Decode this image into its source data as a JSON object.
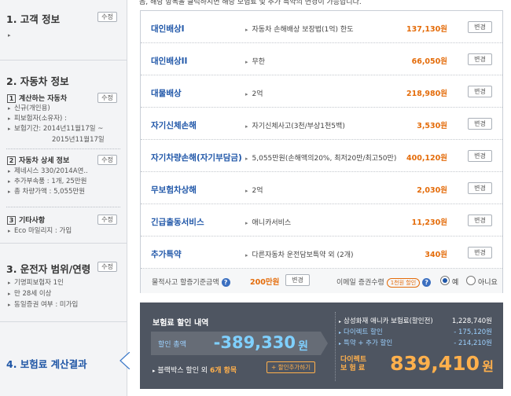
{
  "sidebar": {
    "edit_label": "수정",
    "customer": {
      "title": "1. 고객 정보"
    },
    "car": {
      "title": "2. 자동차 정보",
      "sub1": {
        "num": "1",
        "title": "계산하는 자동차",
        "items": [
          "신규(개인용)",
          "피보험자(소유자) :",
          "보험기간: 2014년11월17일 ~"
        ],
        "indent": "2015년11월17일"
      },
      "sub2": {
        "num": "2",
        "title": "자동차 상세 정보",
        "items": [
          "제네시스 330/2014A연..",
          "추가부속품 : 1개, 25만원",
          "총 차량가액 : 5,055만원"
        ]
      },
      "sub3": {
        "num": "3",
        "title": "기타사항",
        "items": [
          "Eco 마일리지 : 가입"
        ]
      }
    },
    "driver": {
      "title": "3. 운전자 범위/연령",
      "items": [
        "기명피보험자 1인",
        "만 28세 이상",
        "동일증권 여부 : 미가입"
      ]
    },
    "result": {
      "title": "4. 보험료 계산결과"
    }
  },
  "top_text": "음, 해당 항목을 클릭하시면 해당 보험료 및 추가 특약의 변경이 가능합니다.",
  "coverage": {
    "change_label": "변경",
    "rows": [
      {
        "name": "대인배상I",
        "desc": "자동차 손해배상 보장법(1억) 한도",
        "price": "137,130원"
      },
      {
        "name": "대인배상II",
        "desc": "무한",
        "price": "66,050원"
      },
      {
        "name": "대물배상",
        "desc": "2억",
        "price": "218,980원"
      },
      {
        "name": "자기신체손해",
        "desc": "자기신체사고(3천/부상1천5백)",
        "price": "3,530원"
      },
      {
        "name": "자기차량손해(자기부담금)",
        "desc": "5,055만원(손해액의20%, 최저20만/최고50만)",
        "price": "400,120원"
      },
      {
        "name": "무보험차상해",
        "desc": "2억",
        "price": "2,030원"
      },
      {
        "name": "긴급출동서비스",
        "desc": "애니카서비스",
        "price": "11,230원"
      },
      {
        "name": "추가특약",
        "desc": "다른자동차 운전담보특약 외 (2개)",
        "price": "340원"
      }
    ],
    "footer": {
      "damage_label": "물적사고 할증기준금액",
      "damage_value": "200만원",
      "email_label": "이메일 증권수령",
      "email_badge": "1천원 할인",
      "yes": "예",
      "no": "아니요"
    }
  },
  "discount": {
    "title": "보험료 할인 내역",
    "total_label": "할인 총액",
    "total_value": "-389,330",
    "won": "원",
    "blackbox_prefix": "블랙박스 할인 외",
    "blackbox_count": "6개 항목",
    "blackbox_btn": "할인추가하기",
    "breakdown": [
      {
        "label": "삼성화재 애니카 보험료(할인전)",
        "value": "1,228,740원"
      },
      {
        "label": "다이렉트 할인",
        "value": "- 175,120원"
      },
      {
        "label": "특약 + 추가 할인",
        "value": "- 214,210원"
      }
    ],
    "final_label_1": "다이렉트",
    "final_label_2": "보 험 료",
    "final_value": "839,410",
    "colors": {
      "accent_orange": "#ffb04c",
      "accent_cyan": "#7fd0ff",
      "panel_bg": "#4e5561"
    }
  }
}
